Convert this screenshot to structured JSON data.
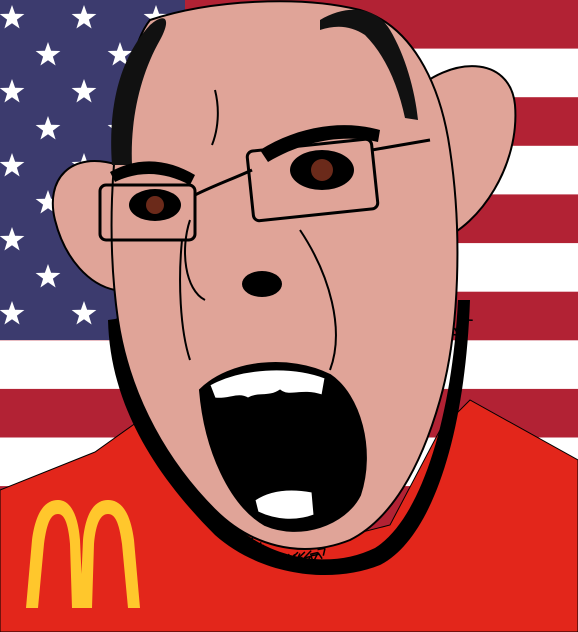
{
  "scene": {
    "background": "us-flag",
    "subject": "angry-bearded-man-cartoon",
    "shirt_logo": "golden-arches-logo"
  },
  "colors": {
    "flag_red": "#B22234",
    "flag_white": "#FFFFFF",
    "flag_blue": "#3C3B6E",
    "skin": "#E0A498",
    "shirt": "#E3261B",
    "logo_yellow": "#FFC72C",
    "mouth": "#000000",
    "teeth": "#FFFFFF",
    "eyes": "#6B2A1A",
    "outline": "#000000"
  }
}
